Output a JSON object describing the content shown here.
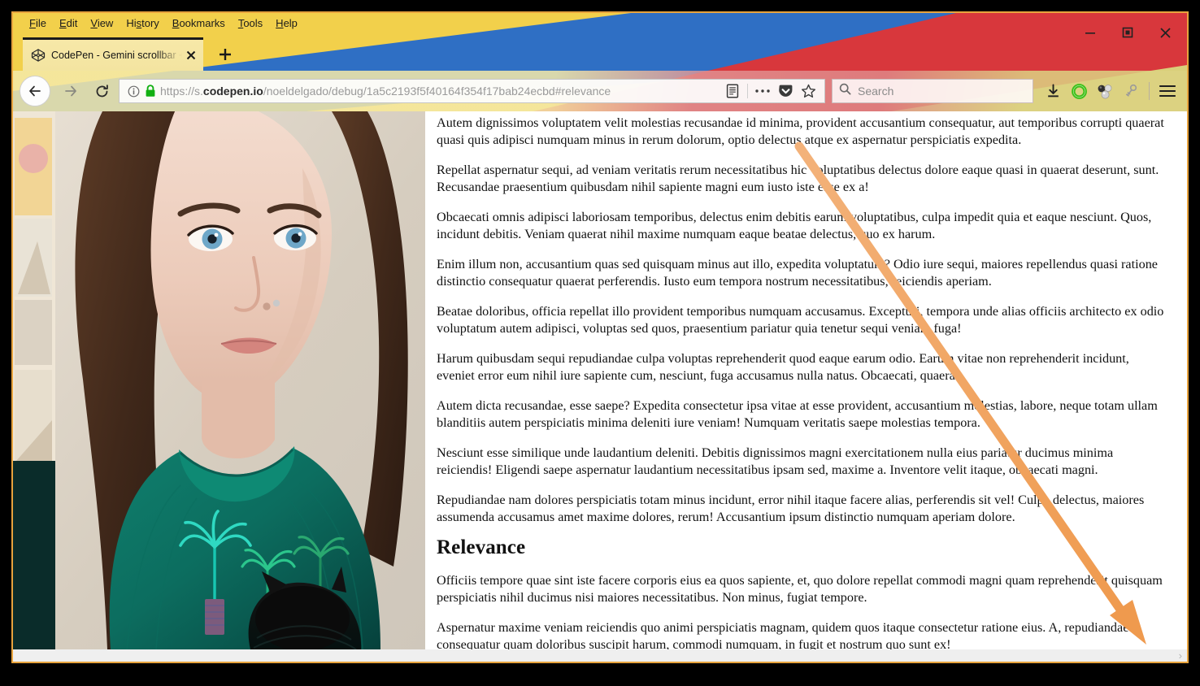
{
  "window": {
    "frame_border_color": "#e8a33d",
    "theme_colors": {
      "yellow": "#f2d04b",
      "blue": "#2f6fc4",
      "red": "#d8373c"
    },
    "controls": {
      "minimize_label": "Minimize",
      "maximize_label": "Maximize",
      "close_label": "Close"
    }
  },
  "menubar": {
    "items": [
      {
        "label": "File",
        "accel": "F"
      },
      {
        "label": "Edit",
        "accel": "E"
      },
      {
        "label": "View",
        "accel": "V"
      },
      {
        "label": "History",
        "accel": "s"
      },
      {
        "label": "Bookmarks",
        "accel": "B"
      },
      {
        "label": "Tools",
        "accel": "T"
      },
      {
        "label": "Help",
        "accel": "H"
      }
    ]
  },
  "tabs": {
    "active": 0,
    "items": [
      {
        "title": "CodePen - Gemini scrollbar + p",
        "favicon": "codepen-icon",
        "close_label": "×"
      }
    ],
    "new_tab_label": "+"
  },
  "navbar": {
    "back_label": "Back",
    "forward_label": "Forward",
    "reload_label": "Reload",
    "url_prefix": "https://s.",
    "url_domain": "codepen.io",
    "url_path": "/noeldelgado/debug/1a5c2193f5f40164f354f17bab24ecbd#relevance",
    "url_full": "https://s.codepen.io/noeldelgado/debug/1a5c2193f5f40164f354f17bab24ecbd#relevance",
    "identity_icon": "info-circle-icon",
    "lock_icon": "padlock-icon",
    "reader_icon": "reader-mode-icon",
    "page_actions_icon": "ellipsis-icon",
    "pocket_icon": "pocket-icon",
    "bookmark_icon": "star-icon",
    "search_placeholder": "Search",
    "search_value": "",
    "downloads_icon": "download-arrow-icon",
    "extension_green_icon": "green-ring-icon",
    "extension_molecule_icon": "molecule-icon",
    "extension_key_icon": "key-icon",
    "menu_icon": "hamburger-menu-icon"
  },
  "page": {
    "image_alt": "Portrait photo of a woman with blue eyes wearing a green turtleneck sweater with palm-tree pins, holding a black cat",
    "paragraphs": [
      "Autem dignissimos voluptatem velit molestias recusandae id minima, provident accusantium consequatur, aut temporibus corrupti quaerat quasi quis adipisci numquam minus in rerum dolorum, optio delectus atque ex aspernatur perspiciatis expedita.",
      "Repellat aspernatur sequi, ad veniam veritatis rerum necessitatibus hic voluptatibus delectus dolore eaque quasi in quaerat deserunt, sunt. Recusandae praesentium quibusdam nihil sapiente magni eum iusto iste esse ex a!",
      "Obcaecati omnis adipisci laboriosam temporibus, delectus enim debitis earum voluptatibus, culpa impedit quia et eaque nesciunt. Quos, incidunt debitis. Veniam quaerat nihil maxime numquam eaque beatae delectus, quo ex harum.",
      "Enim illum non, accusantium quas sed quisquam minus aut illo, expedita voluptatum? Odio iure sequi, maiores repellendus quasi ratione distinctio consequatur quaerat perferendis. Iusto eum tempora nostrum necessitatibus, reiciendis aperiam.",
      "Beatae doloribus, officia repellat illo provident temporibus numquam accusamus. Excepturi, tempora unde alias officiis architecto ex odio voluptatum autem adipisci, voluptas sed quos, praesentium pariatur quia tenetur sequi veniam fuga!",
      "Harum quibusdam sequi repudiandae culpa voluptas reprehenderit quod eaque earum odio. Earum vitae non reprehenderit incidunt, eveniet error eum nihil iure sapiente cum, nesciunt, fuga accusamus nulla natus. Obcaecati, quaerat.",
      "Autem dicta recusandae, esse saepe? Expedita consectetur ipsa vitae at esse provident, accusantium molestias, labore, neque totam ullam blanditiis autem perspiciatis minima deleniti iure veniam! Numquam veritatis saepe molestias tempora.",
      "Nesciunt esse similique unde laudantium deleniti. Debitis dignissimos magni exercitationem nulla eius pariatur ducimus minima reiciendis! Eligendi saepe aspernatur laudantium necessitatibus ipsam sed, maxime a. Inventore velit itaque, obcaecati magni.",
      "Repudiandae nam dolores perspiciatis totam minus incidunt, error nihil itaque facere alias, perferendis sit vel! Culpa delectus, maiores assumenda accusamus amet maxime dolores, rerum! Accusantium ipsum distinctio numquam aperiam dolore."
    ],
    "heading": "Relevance",
    "paragraphs_after": [
      "Officiis tempore quae sint iste facere corporis eius ea quos sapiente, et, quo dolore repellat commodi magni quam reprehenderit quisquam perspiciatis nihil ducimus nisi maiores necessitatibus. Non minus, fugiat tempore.",
      "Aspernatur maxime veniam reiciendis quo animi perspiciatis magnam, quidem quos itaque consectetur ratione eius. A, repudiandae consequatur quam doloribus suscipit harum, commodi numquam, in fugit et nostrum quo sunt ex!"
    ],
    "hscrollbar": {
      "arrow_right": "›",
      "track_color": "#efefef"
    }
  },
  "annotation": {
    "pointer_color": "#f0a760",
    "pointer_label": "pointer-arrow"
  }
}
